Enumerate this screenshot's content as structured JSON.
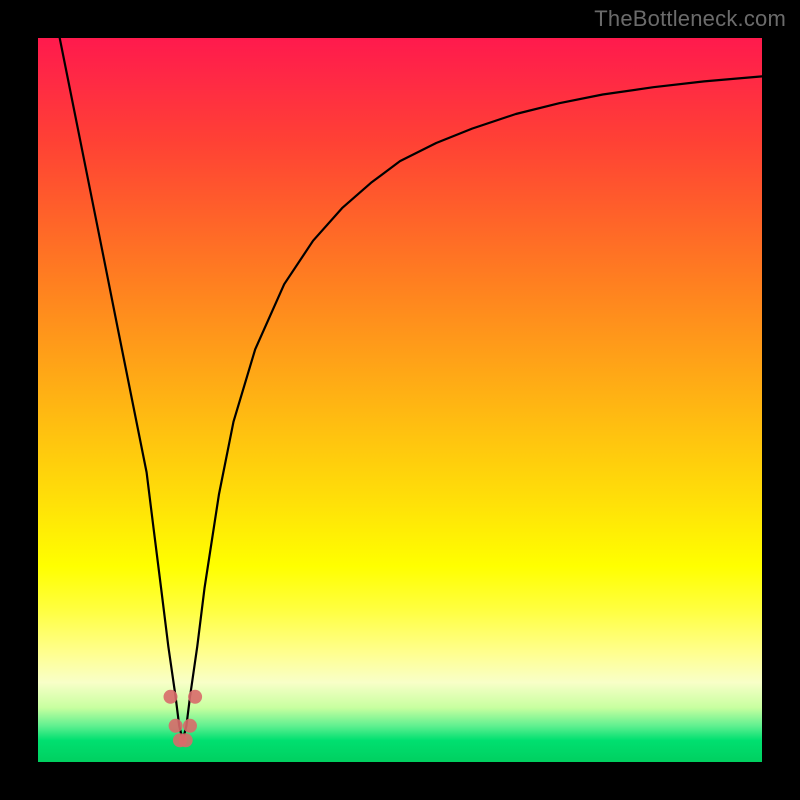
{
  "watermark": "TheBottleneck.com",
  "chart_data": {
    "type": "line",
    "title": "",
    "xlabel": "",
    "ylabel": "",
    "xlim": [
      0,
      100
    ],
    "ylim": [
      0,
      100
    ],
    "series": [
      {
        "name": "bottleneck-curve",
        "x": [
          3,
          5,
          7,
          9,
          11,
          13,
          15,
          16,
          17,
          18,
          19,
          19.5,
          20,
          20.5,
          21,
          22,
          23,
          25,
          27,
          30,
          34,
          38,
          42,
          46,
          50,
          55,
          60,
          66,
          72,
          78,
          85,
          92,
          100
        ],
        "y": [
          100,
          90,
          80,
          70,
          60,
          50,
          40,
          32,
          24,
          16,
          9,
          5,
          3,
          5,
          9,
          16,
          24,
          37,
          47,
          57,
          66,
          72,
          76.5,
          80,
          83,
          85.5,
          87.5,
          89.5,
          91,
          92.2,
          93.2,
          94,
          94.7
        ]
      }
    ],
    "markers": {
      "name": "trough-dots",
      "x": [
        18.3,
        19.0,
        19.6,
        20.4,
        21.0,
        21.7
      ],
      "y": [
        9.0,
        5.0,
        3.0,
        3.0,
        5.0,
        9.0
      ]
    },
    "gradient_stops": [
      {
        "pct": 0,
        "color": "#ff1a4d"
      },
      {
        "pct": 34,
        "color": "#ff8020"
      },
      {
        "pct": 73,
        "color": "#ffff00"
      },
      {
        "pct": 92,
        "color": "#c8ffa0"
      },
      {
        "pct": 100,
        "color": "#00d060"
      }
    ]
  }
}
